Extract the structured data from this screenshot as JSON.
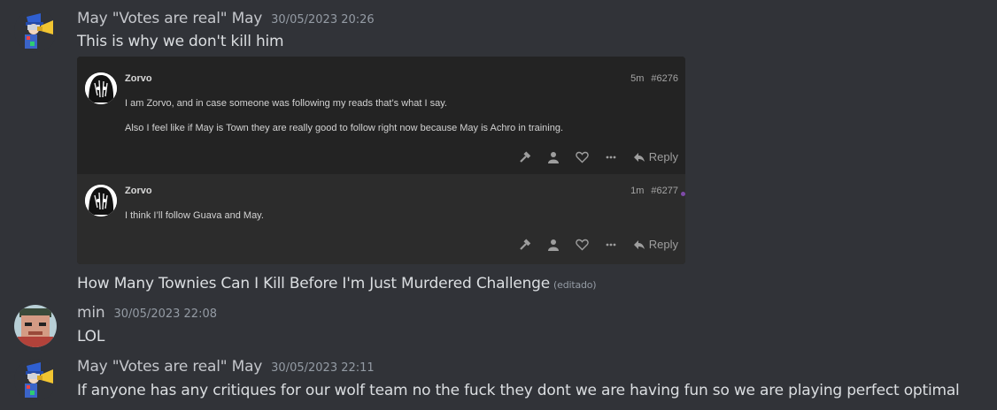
{
  "messages": [
    {
      "author": "May \"Votes are real\" May",
      "timestamp": "30/05/2023 20:26",
      "text": "This is why we don't kill him",
      "avatar_icon": "mayor-megaphone-avatar"
    },
    {
      "text": "How Many Townies Can I Kill Before I'm Just Murdered Challenge",
      "edited_label": "(editado)"
    },
    {
      "author": "min",
      "timestamp": "30/05/2023 22:08",
      "text": "LOL",
      "avatar_icon": "pixel-face-avatar"
    },
    {
      "author": "May \"Votes are real\" May",
      "timestamp": "30/05/2023 22:11",
      "text": "If anyone has any critiques for our wolf team no the fuck they dont we are having fun so we are playing perfect optimal",
      "avatar_icon": "mayor-megaphone-avatar"
    }
  ],
  "embed": {
    "posts": [
      {
        "name": "Zorvo",
        "age": "5m",
        "number": "#6276",
        "lines": [
          "I am Zorvo, and in case someone was following my reads that’s what I say.",
          "Also I feel like if May is Town they are really good to follow right now because May is Achro in training."
        ],
        "reply_label": "Reply"
      },
      {
        "name": "Zorvo",
        "age": "1m",
        "number": "#6277",
        "lines": [
          "I think I’ll follow Guava and May."
        ],
        "reply_label": "Reply"
      }
    ]
  },
  "colors": {
    "background": "#313338",
    "embed_bg": "#232323",
    "unread_dot": "#7e4aa8"
  }
}
